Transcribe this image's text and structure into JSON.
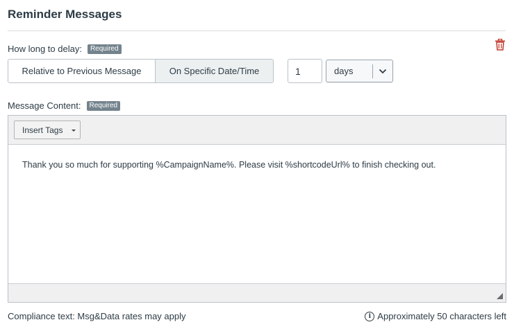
{
  "section": {
    "title": "Reminder Messages"
  },
  "delay": {
    "label": "How long to delay:",
    "required_badge": "Required",
    "options": [
      "Relative to Previous Message",
      "On Specific Date/Time"
    ],
    "selected_option": "On Specific Date/Time",
    "amount": "1",
    "unit": "days"
  },
  "content": {
    "label": "Message Content:",
    "required_badge": "Required",
    "insert_tags_label": "Insert Tags",
    "message": "Thank you so much for supporting %CampaignName%. Please visit %shortcodeUrl% to finish checking out."
  },
  "footer": {
    "compliance": "Compliance text: Msg&Data rates may apply",
    "chars_left": "Approximately 50 characters left"
  },
  "icons": {
    "delete": "trash-icon",
    "select_caret": "chevron-down-icon",
    "info": "info-icon",
    "resize": "resize-handle-icon"
  },
  "colors": {
    "delete": "#c0392b",
    "badge": "#74838d",
    "selected_segment": "#ecf0f1"
  }
}
